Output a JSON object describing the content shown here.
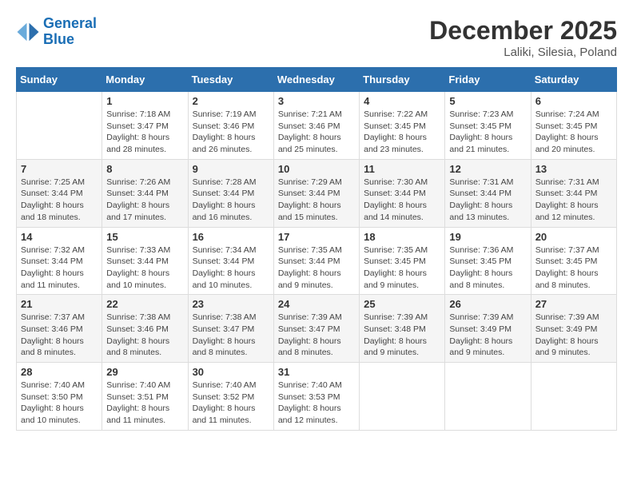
{
  "header": {
    "logo_line1": "General",
    "logo_line2": "Blue",
    "month": "December 2025",
    "location": "Laliki, Silesia, Poland"
  },
  "weekdays": [
    "Sunday",
    "Monday",
    "Tuesday",
    "Wednesday",
    "Thursday",
    "Friday",
    "Saturday"
  ],
  "weeks": [
    [
      {
        "day": "",
        "sunrise": "",
        "sunset": "",
        "daylight": ""
      },
      {
        "day": "1",
        "sunrise": "Sunrise: 7:18 AM",
        "sunset": "Sunset: 3:47 PM",
        "daylight": "Daylight: 8 hours and 28 minutes."
      },
      {
        "day": "2",
        "sunrise": "Sunrise: 7:19 AM",
        "sunset": "Sunset: 3:46 PM",
        "daylight": "Daylight: 8 hours and 26 minutes."
      },
      {
        "day": "3",
        "sunrise": "Sunrise: 7:21 AM",
        "sunset": "Sunset: 3:46 PM",
        "daylight": "Daylight: 8 hours and 25 minutes."
      },
      {
        "day": "4",
        "sunrise": "Sunrise: 7:22 AM",
        "sunset": "Sunset: 3:45 PM",
        "daylight": "Daylight: 8 hours and 23 minutes."
      },
      {
        "day": "5",
        "sunrise": "Sunrise: 7:23 AM",
        "sunset": "Sunset: 3:45 PM",
        "daylight": "Daylight: 8 hours and 21 minutes."
      },
      {
        "day": "6",
        "sunrise": "Sunrise: 7:24 AM",
        "sunset": "Sunset: 3:45 PM",
        "daylight": "Daylight: 8 hours and 20 minutes."
      }
    ],
    [
      {
        "day": "7",
        "sunrise": "Sunrise: 7:25 AM",
        "sunset": "Sunset: 3:44 PM",
        "daylight": "Daylight: 8 hours and 18 minutes."
      },
      {
        "day": "8",
        "sunrise": "Sunrise: 7:26 AM",
        "sunset": "Sunset: 3:44 PM",
        "daylight": "Daylight: 8 hours and 17 minutes."
      },
      {
        "day": "9",
        "sunrise": "Sunrise: 7:28 AM",
        "sunset": "Sunset: 3:44 PM",
        "daylight": "Daylight: 8 hours and 16 minutes."
      },
      {
        "day": "10",
        "sunrise": "Sunrise: 7:29 AM",
        "sunset": "Sunset: 3:44 PM",
        "daylight": "Daylight: 8 hours and 15 minutes."
      },
      {
        "day": "11",
        "sunrise": "Sunrise: 7:30 AM",
        "sunset": "Sunset: 3:44 PM",
        "daylight": "Daylight: 8 hours and 14 minutes."
      },
      {
        "day": "12",
        "sunrise": "Sunrise: 7:31 AM",
        "sunset": "Sunset: 3:44 PM",
        "daylight": "Daylight: 8 hours and 13 minutes."
      },
      {
        "day": "13",
        "sunrise": "Sunrise: 7:31 AM",
        "sunset": "Sunset: 3:44 PM",
        "daylight": "Daylight: 8 hours and 12 minutes."
      }
    ],
    [
      {
        "day": "14",
        "sunrise": "Sunrise: 7:32 AM",
        "sunset": "Sunset: 3:44 PM",
        "daylight": "Daylight: 8 hours and 11 minutes."
      },
      {
        "day": "15",
        "sunrise": "Sunrise: 7:33 AM",
        "sunset": "Sunset: 3:44 PM",
        "daylight": "Daylight: 8 hours and 10 minutes."
      },
      {
        "day": "16",
        "sunrise": "Sunrise: 7:34 AM",
        "sunset": "Sunset: 3:44 PM",
        "daylight": "Daylight: 8 hours and 10 minutes."
      },
      {
        "day": "17",
        "sunrise": "Sunrise: 7:35 AM",
        "sunset": "Sunset: 3:44 PM",
        "daylight": "Daylight: 8 hours and 9 minutes."
      },
      {
        "day": "18",
        "sunrise": "Sunrise: 7:35 AM",
        "sunset": "Sunset: 3:45 PM",
        "daylight": "Daylight: 8 hours and 9 minutes."
      },
      {
        "day": "19",
        "sunrise": "Sunrise: 7:36 AM",
        "sunset": "Sunset: 3:45 PM",
        "daylight": "Daylight: 8 hours and 8 minutes."
      },
      {
        "day": "20",
        "sunrise": "Sunrise: 7:37 AM",
        "sunset": "Sunset: 3:45 PM",
        "daylight": "Daylight: 8 hours and 8 minutes."
      }
    ],
    [
      {
        "day": "21",
        "sunrise": "Sunrise: 7:37 AM",
        "sunset": "Sunset: 3:46 PM",
        "daylight": "Daylight: 8 hours and 8 minutes."
      },
      {
        "day": "22",
        "sunrise": "Sunrise: 7:38 AM",
        "sunset": "Sunset: 3:46 PM",
        "daylight": "Daylight: 8 hours and 8 minutes."
      },
      {
        "day": "23",
        "sunrise": "Sunrise: 7:38 AM",
        "sunset": "Sunset: 3:47 PM",
        "daylight": "Daylight: 8 hours and 8 minutes."
      },
      {
        "day": "24",
        "sunrise": "Sunrise: 7:39 AM",
        "sunset": "Sunset: 3:47 PM",
        "daylight": "Daylight: 8 hours and 8 minutes."
      },
      {
        "day": "25",
        "sunrise": "Sunrise: 7:39 AM",
        "sunset": "Sunset: 3:48 PM",
        "daylight": "Daylight: 8 hours and 9 minutes."
      },
      {
        "day": "26",
        "sunrise": "Sunrise: 7:39 AM",
        "sunset": "Sunset: 3:49 PM",
        "daylight": "Daylight: 8 hours and 9 minutes."
      },
      {
        "day": "27",
        "sunrise": "Sunrise: 7:39 AM",
        "sunset": "Sunset: 3:49 PM",
        "daylight": "Daylight: 8 hours and 9 minutes."
      }
    ],
    [
      {
        "day": "28",
        "sunrise": "Sunrise: 7:40 AM",
        "sunset": "Sunset: 3:50 PM",
        "daylight": "Daylight: 8 hours and 10 minutes."
      },
      {
        "day": "29",
        "sunrise": "Sunrise: 7:40 AM",
        "sunset": "Sunset: 3:51 PM",
        "daylight": "Daylight: 8 hours and 11 minutes."
      },
      {
        "day": "30",
        "sunrise": "Sunrise: 7:40 AM",
        "sunset": "Sunset: 3:52 PM",
        "daylight": "Daylight: 8 hours and 11 minutes."
      },
      {
        "day": "31",
        "sunrise": "Sunrise: 7:40 AM",
        "sunset": "Sunset: 3:53 PM",
        "daylight": "Daylight: 8 hours and 12 minutes."
      },
      {
        "day": "",
        "sunrise": "",
        "sunset": "",
        "daylight": ""
      },
      {
        "day": "",
        "sunrise": "",
        "sunset": "",
        "daylight": ""
      },
      {
        "day": "",
        "sunrise": "",
        "sunset": "",
        "daylight": ""
      }
    ]
  ]
}
